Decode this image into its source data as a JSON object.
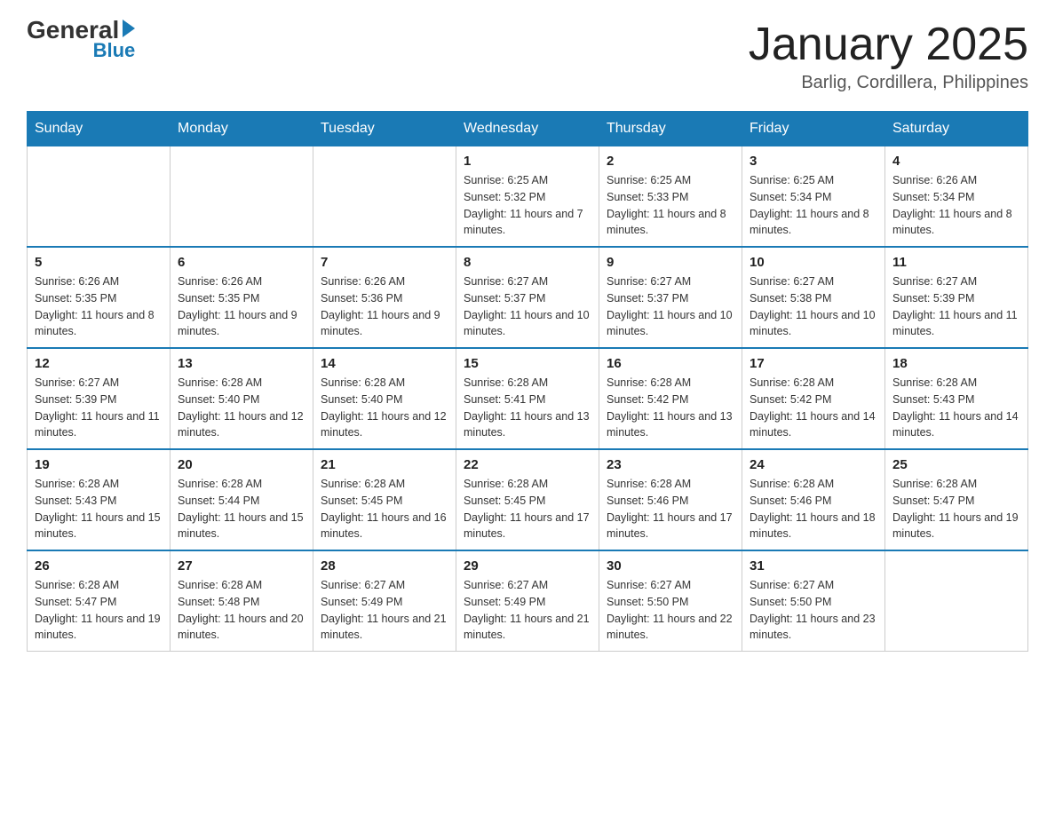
{
  "logo": {
    "text_general": "General",
    "text_blue": "Blue",
    "arrow": true
  },
  "header": {
    "month_title": "January 2025",
    "location": "Barlig, Cordillera, Philippines"
  },
  "days_of_week": [
    "Sunday",
    "Monday",
    "Tuesday",
    "Wednesday",
    "Thursday",
    "Friday",
    "Saturday"
  ],
  "weeks": [
    [
      {
        "day": "",
        "info": ""
      },
      {
        "day": "",
        "info": ""
      },
      {
        "day": "",
        "info": ""
      },
      {
        "day": "1",
        "info": "Sunrise: 6:25 AM\nSunset: 5:32 PM\nDaylight: 11 hours and 7 minutes."
      },
      {
        "day": "2",
        "info": "Sunrise: 6:25 AM\nSunset: 5:33 PM\nDaylight: 11 hours and 8 minutes."
      },
      {
        "day": "3",
        "info": "Sunrise: 6:25 AM\nSunset: 5:34 PM\nDaylight: 11 hours and 8 minutes."
      },
      {
        "day": "4",
        "info": "Sunrise: 6:26 AM\nSunset: 5:34 PM\nDaylight: 11 hours and 8 minutes."
      }
    ],
    [
      {
        "day": "5",
        "info": "Sunrise: 6:26 AM\nSunset: 5:35 PM\nDaylight: 11 hours and 8 minutes."
      },
      {
        "day": "6",
        "info": "Sunrise: 6:26 AM\nSunset: 5:35 PM\nDaylight: 11 hours and 9 minutes."
      },
      {
        "day": "7",
        "info": "Sunrise: 6:26 AM\nSunset: 5:36 PM\nDaylight: 11 hours and 9 minutes."
      },
      {
        "day": "8",
        "info": "Sunrise: 6:27 AM\nSunset: 5:37 PM\nDaylight: 11 hours and 10 minutes."
      },
      {
        "day": "9",
        "info": "Sunrise: 6:27 AM\nSunset: 5:37 PM\nDaylight: 11 hours and 10 minutes."
      },
      {
        "day": "10",
        "info": "Sunrise: 6:27 AM\nSunset: 5:38 PM\nDaylight: 11 hours and 10 minutes."
      },
      {
        "day": "11",
        "info": "Sunrise: 6:27 AM\nSunset: 5:39 PM\nDaylight: 11 hours and 11 minutes."
      }
    ],
    [
      {
        "day": "12",
        "info": "Sunrise: 6:27 AM\nSunset: 5:39 PM\nDaylight: 11 hours and 11 minutes."
      },
      {
        "day": "13",
        "info": "Sunrise: 6:28 AM\nSunset: 5:40 PM\nDaylight: 11 hours and 12 minutes."
      },
      {
        "day": "14",
        "info": "Sunrise: 6:28 AM\nSunset: 5:40 PM\nDaylight: 11 hours and 12 minutes."
      },
      {
        "day": "15",
        "info": "Sunrise: 6:28 AM\nSunset: 5:41 PM\nDaylight: 11 hours and 13 minutes."
      },
      {
        "day": "16",
        "info": "Sunrise: 6:28 AM\nSunset: 5:42 PM\nDaylight: 11 hours and 13 minutes."
      },
      {
        "day": "17",
        "info": "Sunrise: 6:28 AM\nSunset: 5:42 PM\nDaylight: 11 hours and 14 minutes."
      },
      {
        "day": "18",
        "info": "Sunrise: 6:28 AM\nSunset: 5:43 PM\nDaylight: 11 hours and 14 minutes."
      }
    ],
    [
      {
        "day": "19",
        "info": "Sunrise: 6:28 AM\nSunset: 5:43 PM\nDaylight: 11 hours and 15 minutes."
      },
      {
        "day": "20",
        "info": "Sunrise: 6:28 AM\nSunset: 5:44 PM\nDaylight: 11 hours and 15 minutes."
      },
      {
        "day": "21",
        "info": "Sunrise: 6:28 AM\nSunset: 5:45 PM\nDaylight: 11 hours and 16 minutes."
      },
      {
        "day": "22",
        "info": "Sunrise: 6:28 AM\nSunset: 5:45 PM\nDaylight: 11 hours and 17 minutes."
      },
      {
        "day": "23",
        "info": "Sunrise: 6:28 AM\nSunset: 5:46 PM\nDaylight: 11 hours and 17 minutes."
      },
      {
        "day": "24",
        "info": "Sunrise: 6:28 AM\nSunset: 5:46 PM\nDaylight: 11 hours and 18 minutes."
      },
      {
        "day": "25",
        "info": "Sunrise: 6:28 AM\nSunset: 5:47 PM\nDaylight: 11 hours and 19 minutes."
      }
    ],
    [
      {
        "day": "26",
        "info": "Sunrise: 6:28 AM\nSunset: 5:47 PM\nDaylight: 11 hours and 19 minutes."
      },
      {
        "day": "27",
        "info": "Sunrise: 6:28 AM\nSunset: 5:48 PM\nDaylight: 11 hours and 20 minutes."
      },
      {
        "day": "28",
        "info": "Sunrise: 6:27 AM\nSunset: 5:49 PM\nDaylight: 11 hours and 21 minutes."
      },
      {
        "day": "29",
        "info": "Sunrise: 6:27 AM\nSunset: 5:49 PM\nDaylight: 11 hours and 21 minutes."
      },
      {
        "day": "30",
        "info": "Sunrise: 6:27 AM\nSunset: 5:50 PM\nDaylight: 11 hours and 22 minutes."
      },
      {
        "day": "31",
        "info": "Sunrise: 6:27 AM\nSunset: 5:50 PM\nDaylight: 11 hours and 23 minutes."
      },
      {
        "day": "",
        "info": ""
      }
    ]
  ],
  "accent_color": "#1a7ab5"
}
